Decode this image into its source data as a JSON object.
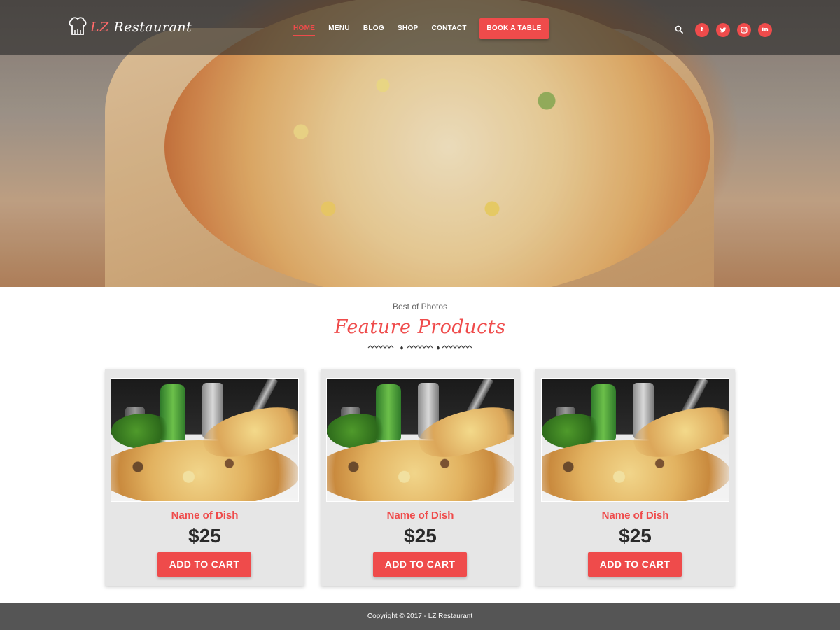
{
  "brand": {
    "logo_prefix": "LZ",
    "logo_name": "Restaurant",
    "logo_icon": "chef-hat-icon",
    "accent_color": "#ef4b4b"
  },
  "nav": {
    "items": [
      {
        "label": "HOME",
        "active": true
      },
      {
        "label": "MENU",
        "active": false
      },
      {
        "label": "BLOG",
        "active": false
      },
      {
        "label": "SHOP",
        "active": false
      },
      {
        "label": "CONTACT",
        "active": false
      }
    ],
    "book_label": "BOOK A TABLE",
    "search_icon": "search-icon",
    "social": [
      {
        "icon": "facebook-icon",
        "glyph": "f"
      },
      {
        "icon": "twitter-icon",
        "glyph": ""
      },
      {
        "icon": "instagram-icon",
        "glyph": ""
      },
      {
        "icon": "linkedin-icon",
        "glyph": "in"
      }
    ]
  },
  "features": {
    "kicker": "Best of Photos",
    "title": "Feature Products",
    "products": [
      {
        "name": "Name of Dish",
        "price": "$25",
        "button": "ADD TO CART"
      },
      {
        "name": "Name of Dish",
        "price": "$25",
        "button": "ADD TO CART"
      },
      {
        "name": "Name of Dish",
        "price": "$25",
        "button": "ADD TO CART"
      }
    ]
  },
  "footer": {
    "copyright": "Copyright © 2017 - LZ Restaurant"
  }
}
